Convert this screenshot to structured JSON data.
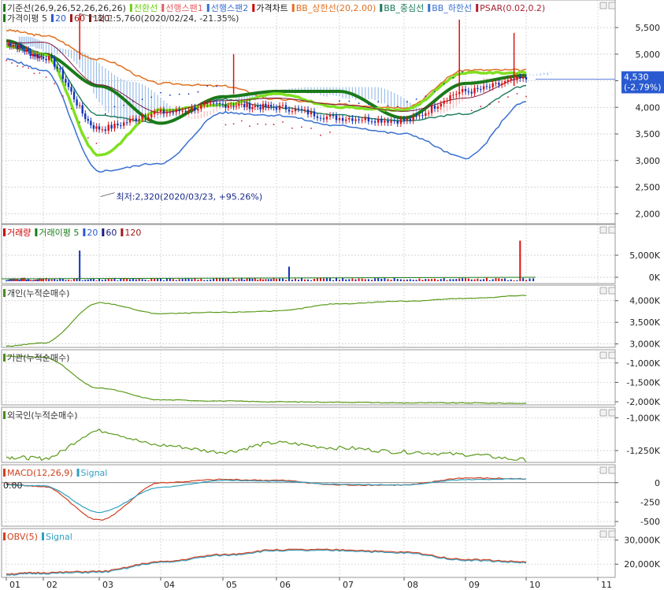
{
  "panes": [
    {
      "id": "price",
      "legend_row1": [
        {
          "text": "기준선(26,9,26,52,26,26,26)",
          "color": "#333333",
          "marker": "#1a7a1a"
        },
        {
          "text": "전환선",
          "color": "#6fcf1a",
          "marker": "#6fcf1a"
        },
        {
          "text": "선행스팬1",
          "color": "#e06060",
          "marker": "#e06060"
        },
        {
          "text": "선행스팬2",
          "color": "#3a70d0",
          "marker": "#3a70d0"
        },
        {
          "text": "가격차트",
          "color": "#111111",
          "marker": "#cc0000"
        },
        {
          "text": "BB_상한선(20,2.00)",
          "color": "#e07020",
          "marker": "#e07020"
        },
        {
          "text": "BB_중심선",
          "color": "#1a7a5a",
          "marker": "#1a7a5a"
        },
        {
          "text": "BB_하한선",
          "color": "#3a70d0",
          "marker": "#3a70d0"
        },
        {
          "text": "PSAR(0.02,0.2)",
          "color": "#aa2233",
          "marker": "#aa2233"
        }
      ],
      "legend_row2": [
        {
          "text": "가격이평 5",
          "color": "#333333",
          "marker": "#1a7a1a"
        },
        {
          "text": "20",
          "color": "#2a5ad0",
          "marker": "#2a5ad0"
        },
        {
          "text": "60",
          "color": "#a01a1a",
          "marker": "#a01a1a"
        },
        {
          "text": "120",
          "color": "#7a1a1a",
          "marker": "#7a1a1a"
        }
      ],
      "annotation_high": "최고:5,760(2020/02/24, -21.35%)",
      "annotation_low": "최저:2,320(2020/03/23, +95.26%)",
      "last_price_label": "4,530",
      "last_change_label": "(-2.79%)",
      "y_ticks": [
        "5,500",
        "5,000",
        "4,500",
        "4,000",
        "3,500",
        "3,000",
        "2,500",
        "2,000"
      ]
    },
    {
      "id": "volume",
      "legend": [
        {
          "text": "거래량",
          "color": "#cc0000",
          "marker": "#cc0000"
        },
        {
          "text": "거래이평 5",
          "color": "#1a7a1a",
          "marker": "#1a7a1a"
        },
        {
          "text": "20",
          "color": "#2a5ad0",
          "marker": "#2a5ad0"
        },
        {
          "text": "60",
          "color": "#1a1a7a",
          "marker": "#1a1a7a"
        },
        {
          "text": "120",
          "color": "#a01a1a",
          "marker": "#a01a1a"
        }
      ],
      "y_ticks": [
        "5,000K",
        "0K"
      ]
    },
    {
      "id": "individual",
      "legend": [
        {
          "text": "개인(누적순매수)",
          "color": "#333333",
          "marker": "#4a8a1a"
        }
      ],
      "y_ticks": [
        "4,000K",
        "3,500K",
        "3,000K"
      ]
    },
    {
      "id": "institution",
      "legend": [
        {
          "text": "기관(누적순매수)",
          "color": "#333333",
          "marker": "#4a8a1a"
        }
      ],
      "y_ticks": [
        "-1,000K",
        "-1,500K",
        "-2,000K"
      ]
    },
    {
      "id": "foreign",
      "legend": [
        {
          "text": "외국인(누적순매수)",
          "color": "#333333",
          "marker": "#4a8a1a"
        }
      ],
      "y_ticks": [
        "-1,000K",
        "-1,250K"
      ]
    },
    {
      "id": "macd",
      "legend": [
        {
          "text": "MACD(12,26,9)",
          "color": "#d04020",
          "marker": "#d04020"
        },
        {
          "text": "Signal",
          "color": "#30a0c0",
          "marker": "#30a0c0"
        }
      ],
      "zero_label": "0.00",
      "y_ticks": [
        "0",
        "-250",
        "-500"
      ]
    },
    {
      "id": "obv",
      "legend": [
        {
          "text": "OBV(5)",
          "color": "#d04020",
          "marker": "#d04020"
        },
        {
          "text": "Signal",
          "color": "#30a0c0",
          "marker": "#30a0c0"
        }
      ],
      "y_ticks": [
        "30,000K",
        "20,000K"
      ]
    }
  ],
  "x_axis_labels": [
    "01",
    "02",
    "03",
    "04",
    "05",
    "06",
    "07",
    "08",
    "09",
    "10",
    "11"
  ],
  "chart_data": {
    "type": "line",
    "x": [
      "01",
      "02",
      "03",
      "04",
      "05",
      "06",
      "07",
      "08",
      "09",
      "10"
    ],
    "price_ylim": [
      1900,
      5900
    ],
    "series": [
      {
        "name": "가격차트",
        "values": [
          5200,
          4950,
          3600,
          3900,
          4050,
          4000,
          3800,
          3750,
          4300,
          4530
        ]
      },
      {
        "name": "BB_상한선(20,2.00)",
        "values": [
          5450,
          5350,
          4900,
          4450,
          4400,
          4150,
          4050,
          4000,
          4700,
          4700
        ]
      },
      {
        "name": "BB_하한선",
        "values": [
          4900,
          4700,
          2800,
          2950,
          3900,
          3850,
          3650,
          3500,
          3050,
          4100
        ]
      },
      {
        "name": "기준선(26,9,26,52,26,26,26)",
        "values": [
          5250,
          5000,
          4400,
          3700,
          4200,
          4300,
          4300,
          3800,
          4450,
          4600
        ]
      },
      {
        "name": "전환선",
        "values": [
          5150,
          5000,
          3100,
          3950,
          4050,
          4250,
          4000,
          3950,
          4650,
          4650
        ]
      },
      {
        "name": "개인(누적순매수)",
        "values": [
          2950,
          3020,
          3950,
          3700,
          3730,
          3760,
          3930,
          3990,
          4050,
          4120
        ]
      },
      {
        "name": "기관(누적순매수)",
        "values": [
          -820,
          -850,
          -1650,
          -1950,
          -1980,
          -2000,
          -2010,
          -2030,
          -2030,
          -2040
        ]
      },
      {
        "name": "외국인(누적순매수)",
        "values": [
          -1300,
          -1310,
          -1100,
          -1210,
          -1260,
          -1190,
          -1230,
          -1260,
          -1280,
          -1320
        ]
      },
      {
        "name": "MACD(12,26,9)",
        "values": [
          -20,
          -50,
          -480,
          0,
          40,
          30,
          -30,
          -30,
          60,
          50
        ]
      },
      {
        "name": "Signal",
        "values": [
          -30,
          -40,
          -380,
          -60,
          30,
          20,
          -20,
          -30,
          40,
          50
        ]
      },
      {
        "name": "OBV(5)",
        "values": [
          16000,
          16500,
          17000,
          21000,
          24000,
          26000,
          26000,
          25000,
          22000,
          21000
        ]
      }
    ],
    "volume_peaks": [
      {
        "x": "02",
        "value": 5900
      },
      {
        "x": "06",
        "value": 2800
      },
      {
        "x": "09",
        "value": 7800
      },
      {
        "x": "10",
        "value": 6000
      }
    ]
  },
  "colors": {
    "cloud_red": "#e88",
    "cloud_blue": "#4a8ad8",
    "up": "#dd1111",
    "down": "#1133bb",
    "grid": "#c8c8c8",
    "panel_border": "#9a9a9a"
  }
}
